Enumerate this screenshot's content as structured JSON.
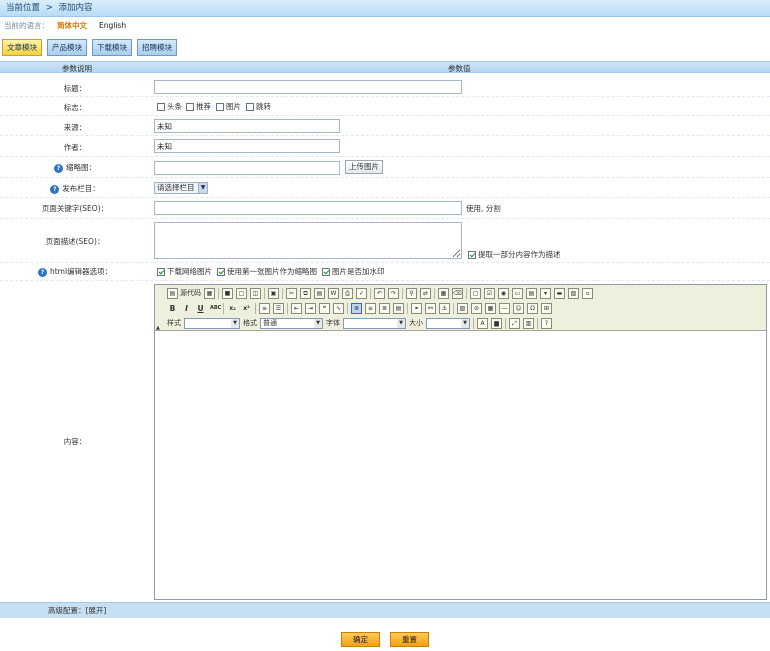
{
  "breadcrumb": {
    "prefix": "当前位置",
    "sep": ">",
    "current": "添加内容"
  },
  "language": {
    "label": "当前的语言：",
    "zh": "简体中文",
    "en": "English"
  },
  "modules": [
    "文章模块",
    "产品模块",
    "下载模块",
    "招聘模块"
  ],
  "header": {
    "param_desc": "参数说明",
    "param_value": "参数值"
  },
  "fields": {
    "title": {
      "label": "标题："
    },
    "flags": {
      "label": "标志：",
      "options": [
        "头条",
        "推荐",
        "图片",
        "跳转"
      ]
    },
    "source": {
      "label": "来源：",
      "value": "未知"
    },
    "author": {
      "label": "作者：",
      "value": "未知"
    },
    "thumb": {
      "label": "缩略图：",
      "upload": "上传图片"
    },
    "column": {
      "label": "发布栏目：",
      "selected": "请选择栏目"
    },
    "keywords": {
      "label": "页面关键字(SEO)：",
      "hint": "使用, 分割"
    },
    "desc": {
      "label": "页面描述(SEO)：",
      "extract": "提取一部分内容作为描述"
    },
    "editor_opts": {
      "label": "html编辑器选项：",
      "options": [
        "下载网络图片",
        "使用第一张图片作为缩略图",
        "图片是否加水印"
      ]
    },
    "content": {
      "label": "内容："
    }
  },
  "editor": {
    "source": "源代码",
    "style": "样式",
    "format": "格式",
    "format_value": "普通",
    "font": "字体",
    "size": "大小"
  },
  "advanced": "高级配置：[展开]",
  "buttons": {
    "ok": "确定",
    "reset": "重置"
  },
  "colors": {
    "accent": "#f3a112",
    "tab_active": "#f3d23d",
    "header_bg": "#b9dbf4"
  }
}
